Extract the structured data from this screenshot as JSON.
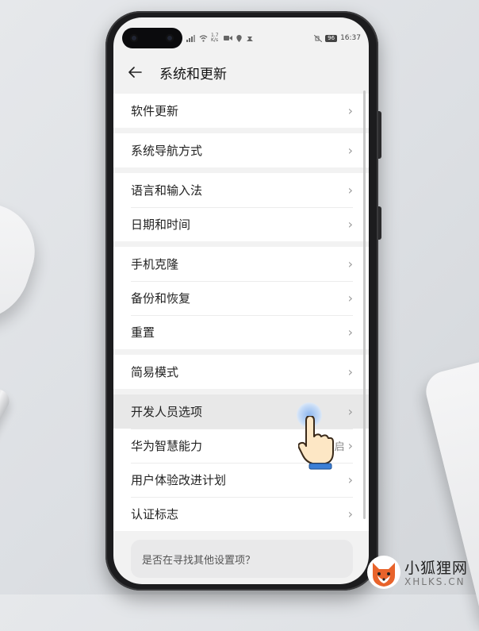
{
  "status_bar": {
    "net_speed": "1.7 K/s",
    "battery": "96",
    "time": "16:37"
  },
  "header": {
    "title": "系统和更新"
  },
  "groups": [
    {
      "items": [
        {
          "label": "软件更新"
        }
      ]
    },
    {
      "items": [
        {
          "label": "系统导航方式"
        }
      ]
    },
    {
      "items": [
        {
          "label": "语言和输入法"
        },
        {
          "label": "日期和时间"
        }
      ]
    },
    {
      "items": [
        {
          "label": "手机克隆"
        },
        {
          "label": "备份和恢复"
        },
        {
          "label": "重置"
        }
      ]
    },
    {
      "items": [
        {
          "label": "简易模式"
        }
      ]
    },
    {
      "items": [
        {
          "label": "开发人员选项"
        },
        {
          "label": "华为智慧能力",
          "value": "启"
        },
        {
          "label": "用户体验改进计划"
        },
        {
          "label": "认证标志"
        }
      ]
    }
  ],
  "search_card": {
    "text": "是否在寻找其他设置项？"
  },
  "watermark": {
    "title": "小狐狸网",
    "subtitle": "XHLKS.CN"
  },
  "colors": {
    "screen_bg": "#f2f2f2",
    "card_bg": "#ffffff",
    "tap_blue": "#8fb7ee",
    "fox_orange": "#e8632b"
  }
}
